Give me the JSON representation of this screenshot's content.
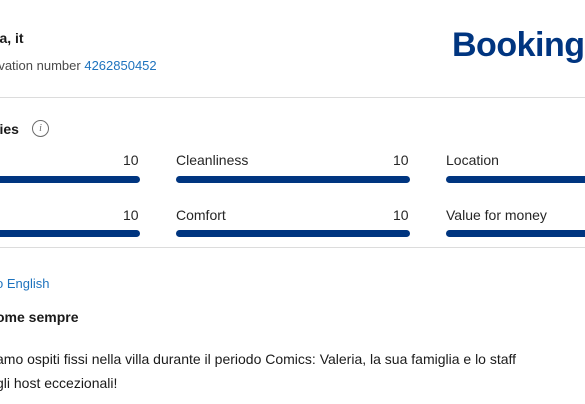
{
  "header": {
    "guest_name": "ra, it",
    "reservation_label": "rvation number",
    "reservation_number": "4262850452",
    "brand": "Booking"
  },
  "categories": {
    "heading": "ries",
    "info_icon": "i",
    "items": [
      {
        "label": "",
        "score": "10"
      },
      {
        "label": "Cleanliness",
        "score": "10"
      },
      {
        "label": "Location",
        "score": ""
      },
      {
        "label": "",
        "score": "10"
      },
      {
        "label": "Comfort",
        "score": "10"
      },
      {
        "label": "Value for money",
        "score": ""
      }
    ]
  },
  "review": {
    "translate_link": "o English",
    "title": "ome sempre",
    "text_line1": "amo ospiti fissi nella villa durante il periodo Comics: Valeria, la sua famiglia e lo staff",
    "text_line2": "gli host eccezionali!"
  },
  "colors": {
    "brand": "#003580",
    "link": "#1e73be",
    "bar": "#003580",
    "divider": "#dcdcdc"
  }
}
